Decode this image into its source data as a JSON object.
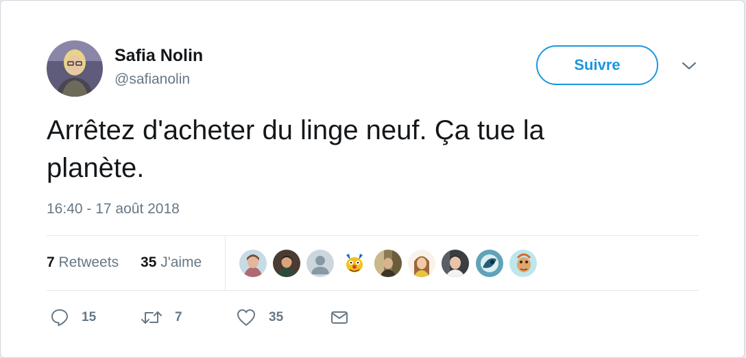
{
  "author": {
    "name": "Safia Nolin",
    "handle": "@safianolin",
    "avatar_icon": "user-avatar"
  },
  "follow_label": "Suivre",
  "tweet": {
    "line1": "Arrêtez d'acheter du linge neuf. Ça tue la",
    "line2": "planète."
  },
  "timestamp": "16:40 - 17 août 2018",
  "stats": {
    "retweets_count": "7",
    "retweets_label": "Retweets",
    "likes_count": "35",
    "likes_label": "J'aime"
  },
  "likers": [
    {
      "icon": "liker-avatar-1"
    },
    {
      "icon": "liker-avatar-2"
    },
    {
      "icon": "default-avatar-icon"
    },
    {
      "icon": "cartoon-face-avatar"
    },
    {
      "icon": "liker-avatar-5"
    },
    {
      "icon": "liker-avatar-6"
    },
    {
      "icon": "liker-avatar-7"
    },
    {
      "icon": "liker-avatar-8"
    },
    {
      "icon": "liker-avatar-9"
    }
  ],
  "actions": {
    "reply_count": "15",
    "retweet_count": "7",
    "like_count": "35"
  },
  "colors": {
    "accent": "#1b95e0",
    "text_primary": "#14171a",
    "text_secondary": "#657786",
    "border": "#e1e8ed"
  }
}
